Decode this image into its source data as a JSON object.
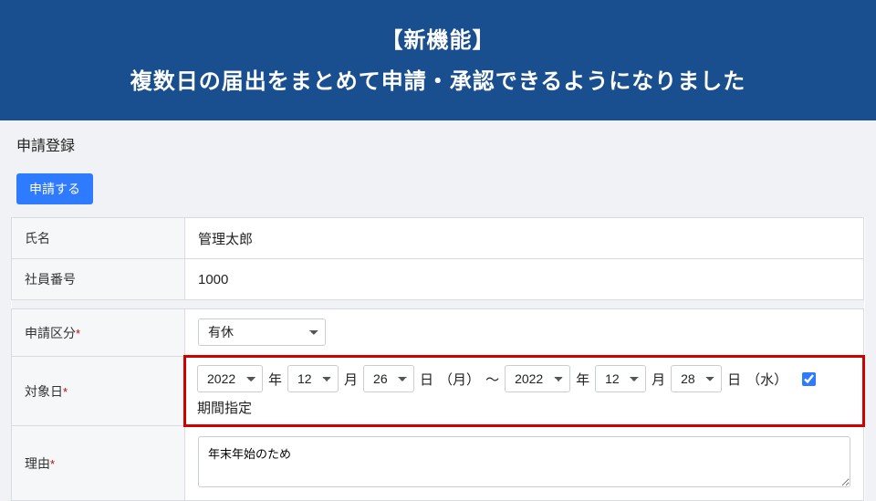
{
  "banner": {
    "title": "【新機能】",
    "subtitle": "複数日の届出をまとめて申請・承認できるようになりました"
  },
  "section": {
    "title": "申請登録",
    "submit_label": "申請する"
  },
  "fields": {
    "name": {
      "label": "氏名",
      "value": "管理太郎"
    },
    "emp_no": {
      "label": "社員番号",
      "value": "1000"
    },
    "type": {
      "label": "申請区分",
      "required": "*",
      "selected": "有休"
    },
    "target": {
      "label": "対象日",
      "required": "*",
      "from": {
        "year": "2022",
        "month": "12",
        "day": "26",
        "weekday": "（月）"
      },
      "to": {
        "year": "2022",
        "month": "12",
        "day": "28",
        "weekday": "（水）"
      },
      "units": {
        "year": "年",
        "month": "月",
        "day": "日",
        "tilde": "～"
      },
      "range_checkbox_label": "期間指定",
      "range_checked": true
    },
    "reason": {
      "label": "理由",
      "required": "*",
      "value": "年末年始のため"
    }
  }
}
